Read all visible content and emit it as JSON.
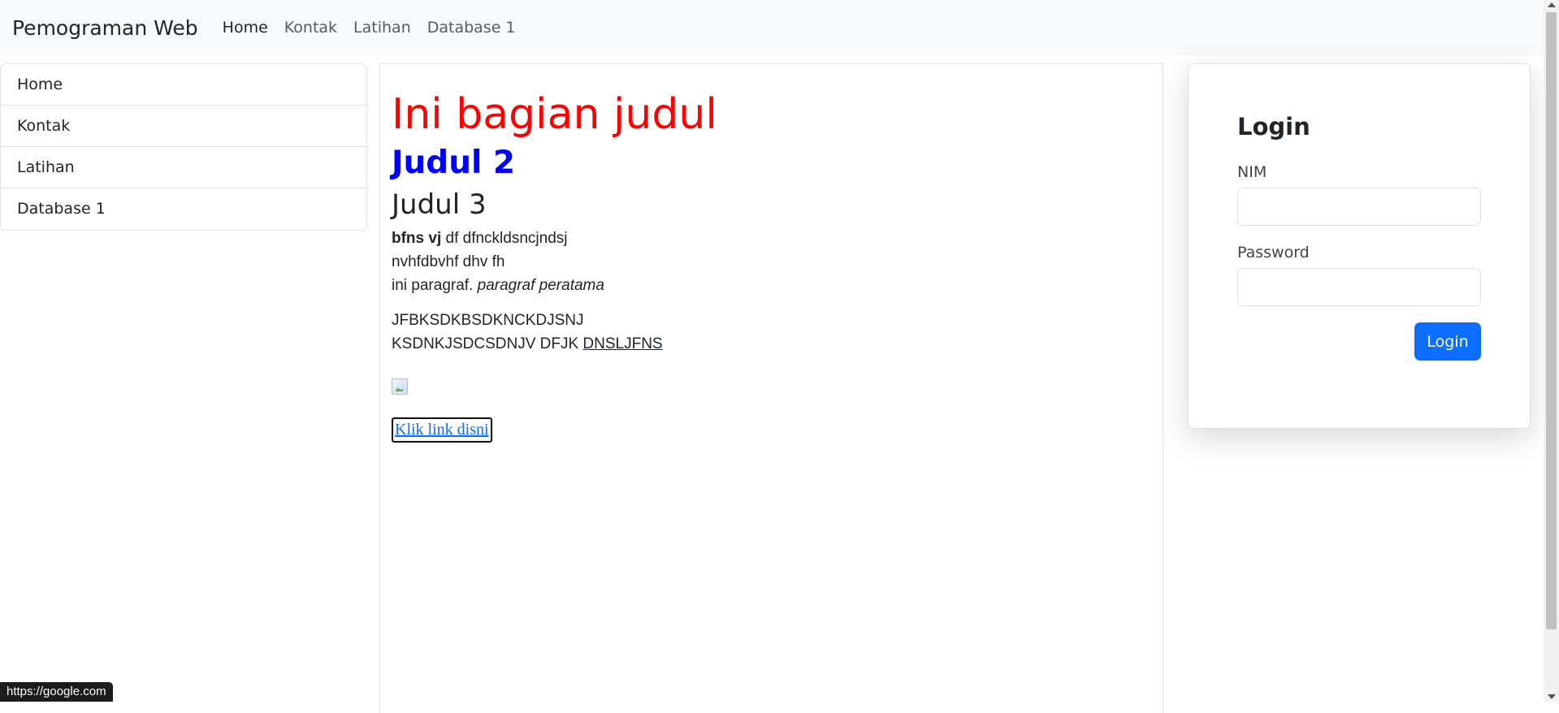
{
  "navbar": {
    "brand": "Pemograman Web",
    "links": [
      "Home",
      "Kontak",
      "Latihan",
      "Database 1"
    ]
  },
  "sidebar": {
    "items": [
      "Home",
      "Kontak",
      "Latihan",
      "Database 1"
    ]
  },
  "main": {
    "heading1": "Ini bagian judul",
    "heading2": "Judul 2",
    "heading3": "Judul 3",
    "para1": {
      "bold": "bfns vj",
      "text1": " df dfnckldsncjndsj",
      "line2": "nvhfdbvhf dhv fh",
      "line3_plain": "ini paragraf. ",
      "line3_italic": "paragraf peratama"
    },
    "para2": {
      "line1": "JFBKSDKBSDKNCKDJSNJ",
      "line2_plain": "KSDNKJSDCSDNJV DFJK ",
      "line2_underline": "DNSLJFNS"
    },
    "link_text": "Klik link disni"
  },
  "login": {
    "title": "Login",
    "nim_label": "NIM",
    "nim_value": "",
    "password_label": "Password",
    "password_value": "",
    "button_label": "Login"
  },
  "status_bar": {
    "url": "https://google.com"
  }
}
